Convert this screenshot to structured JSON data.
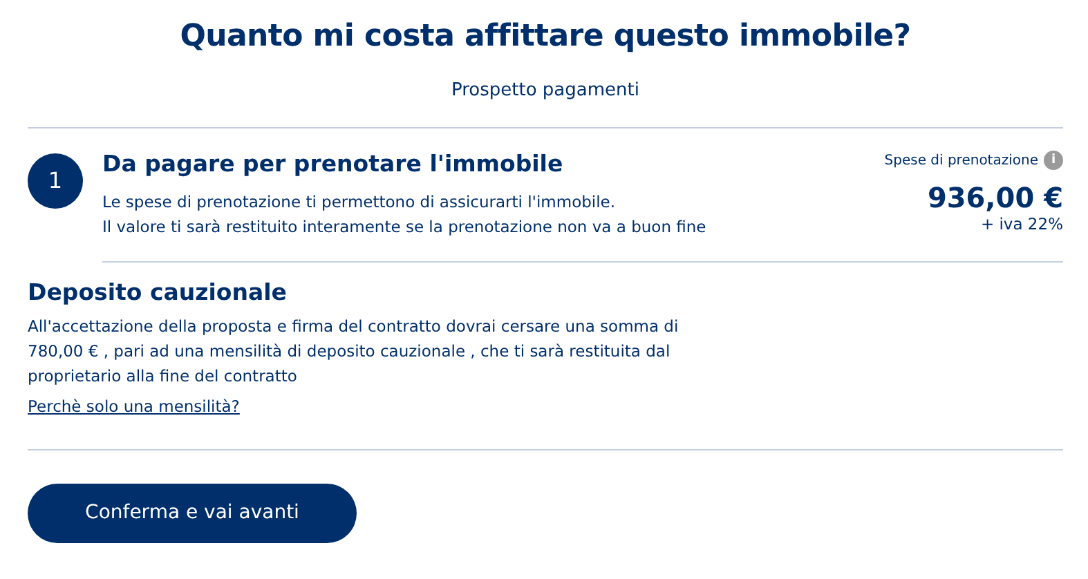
{
  "title": "Quanto mi costa affittare questo immobile?",
  "subtitle": "Prospetto pagamenti",
  "step": {
    "number": "1",
    "title": "Da pagare per prenotare l'immobile",
    "description_lines": [
      "Le spese di prenotazione ti permettono di assicurarti l'immobile.",
      "Il valore ti sarà restituito interamente se la prenotazione non va a buon fine"
    ],
    "price_label": "Spese di prenotazione",
    "info_icon": "i",
    "price": "936,00 €",
    "vat": "+ iva 22%"
  },
  "deposit": {
    "title": "Deposito cauzionale",
    "text_lines": [
      "All'accettazione della proposta e firma del contratto dovrai cersare una somma di",
      "780,00 € , pari ad una mensilità di deposito cauzionale , che ti sarà restituita dal",
      "proprietario alla fine del contratto"
    ],
    "link": "Perchè solo una mensilità?"
  },
  "button": "Conferma e vai avanti"
}
